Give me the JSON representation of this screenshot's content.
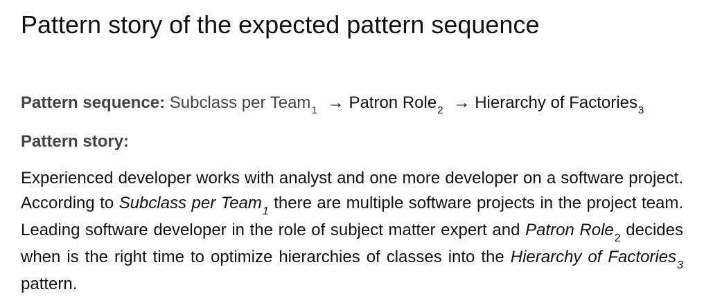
{
  "title": "Pattern story of the expected pattern sequence",
  "sequence": {
    "label": "Pattern sequence:",
    "items": [
      {
        "name": "Subclass per Team",
        "index": "1"
      },
      {
        "name": "Patron Role",
        "index": "2"
      },
      {
        "name": "Hierarchy of Factories",
        "index": "3"
      }
    ],
    "arrow": "→"
  },
  "story": {
    "label": "Pattern story:",
    "text_1": "Experienced developer works with analyst and one more developer on a software project. According to ",
    "pattern_1": "Subclass per Team",
    "pattern_1_index": "1",
    "text_2": " there are multiple software projects in the project team. Leading software developer in the role of subject matter expert and ",
    "pattern_2": "Patron Role",
    "pattern_2_index": "2",
    "text_3": " decides when is the right time to optimize hierarchies of classes into the ",
    "pattern_3": "Hierarchy of Factories",
    "pattern_3_index": "3",
    "text_4": " pattern."
  }
}
